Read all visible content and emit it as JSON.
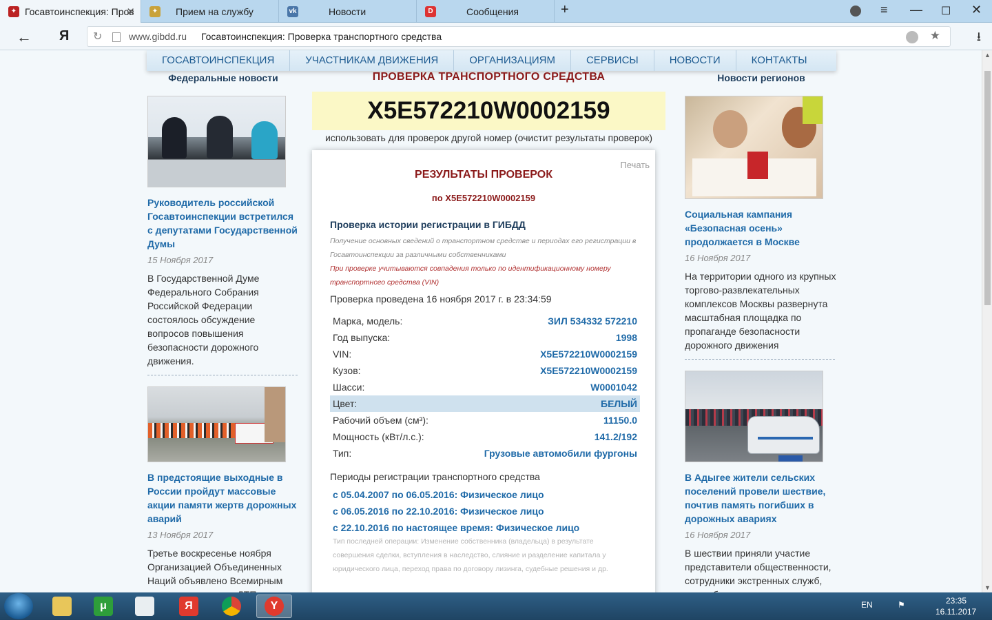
{
  "browser": {
    "tabs": [
      {
        "label": "Госавтоинспекция: Пров",
        "active": true
      },
      {
        "label": "Прием на службу",
        "active": false
      },
      {
        "label": "Новости",
        "active": false
      },
      {
        "label": "Сообщения",
        "active": false
      }
    ],
    "url_domain": "www.gibdd.ru",
    "url_title": "Госавтоинспекция: Проверка транспортного средства",
    "yandex_label": "Я"
  },
  "nav": [
    "ГОСАВТОИНСПЕКЦИЯ",
    "УЧАСТНИКАМ ДВИЖЕНИЯ",
    "ОРГАНИЗАЦИЯМ",
    "СЕРВИСЫ",
    "НОВОСТИ",
    "КОНТАКТЫ"
  ],
  "left": {
    "heading": "Федеральные новости",
    "news": [
      {
        "title": "Руководитель российской Госавтоинспекции встретился с депутатами Государственной Думы",
        "date": "15 Ноября 2017",
        "text": "В Государственной Думе Федерального Собрания Российской Федерации состоялось обсуждение вопросов повышения безопасности дорожного движения."
      },
      {
        "title": "В предстоящие выходные в России пройдут массовые акции памяти жертв дорожных аварий",
        "date": "13 Ноября 2017",
        "text": "Третье воскресенье ноября Организацией Объединенных Наций объявлено Всемирным днем памяти жертв ДТП."
      }
    ]
  },
  "right": {
    "heading": "Новости регионов",
    "news": [
      {
        "title": "Социальная кампания «Безопасная осень» продолжается в Москве",
        "date": "16 Ноября 2017",
        "text": "На территории одного из крупных торгово-развлекательных комплексов Москвы развернута масштабная площадка по пропаганде безопасности дорожного движения"
      },
      {
        "title": "В Адыгее жители сельских поселений провели шествие, почтив память погибших в дорожных авариях",
        "date": "16 Ноября 2017",
        "text": "В шествии приняли участие представители общественности, сотрудники экстренных служб, медработники, учащиеся"
      }
    ]
  },
  "center": {
    "title": "ПРОВЕРКА ТРАНСПОРТНОГО СРЕДСТВА",
    "vin": "X5E572210W0002159",
    "other_number": "использовать для проверок другой номер (очистит результаты проверок)",
    "print": "Печать",
    "results_title": "РЕЗУЛЬТАТЫ ПРОВЕРОК",
    "results_sub": "по X5E572210W0002159",
    "section_title": "Проверка истории регистрации в ГИБДД",
    "section_desc": "Получение основных сведений о транспортном средстве и периодах его регистрации в Госавтоинспекции за различными собственниками",
    "section_warn": "При проверке учитываются совпадения только по идентификационному номеру транспортного средства (VIN)",
    "checked": "Проверка проведена 16 ноября 2017 г. в 23:34:59",
    "specs": [
      {
        "k": "Марка, модель:",
        "v": "ЗИЛ 534332 572210",
        "highlight": false
      },
      {
        "k": "Год выпуска:",
        "v": "1998",
        "highlight": false
      },
      {
        "k": "VIN:",
        "v": "X5E572210W0002159",
        "highlight": false
      },
      {
        "k": "Кузов:",
        "v": "X5E572210W0002159",
        "highlight": false
      },
      {
        "k": "Шасси:",
        "v": "W0001042",
        "highlight": false
      },
      {
        "k": "Цвет:",
        "v": "БЕЛЫЙ",
        "highlight": true
      },
      {
        "k": "Рабочий объем (см³):",
        "v": "11150.0",
        "highlight": false
      },
      {
        "k": "Мощность (кВт/л.с.):",
        "v": "141.2/192",
        "highlight": false
      },
      {
        "k": "Тип:",
        "v": "Грузовые автомобили фургоны",
        "highlight": false
      }
    ],
    "periods_title": "Периоды регистрации транспортного средства",
    "periods": [
      "с 05.04.2007 по 06.05.2016: Физическое лицо",
      "с 06.05.2016 по 22.10.2016: Физическое лицо",
      "с 22.10.2016 по настоящее время: Физическое лицо"
    ],
    "last_op": "Тип последней операции: Изменение собственника (владельца) в результате совершения сделки, вступления в наследство, слияние и разделение капитала у юридического лица, переход права по договору лизинга, судебные решения и др."
  },
  "taskbar": {
    "lang": "EN",
    "time": "23:35",
    "date": "16.11.2017"
  }
}
